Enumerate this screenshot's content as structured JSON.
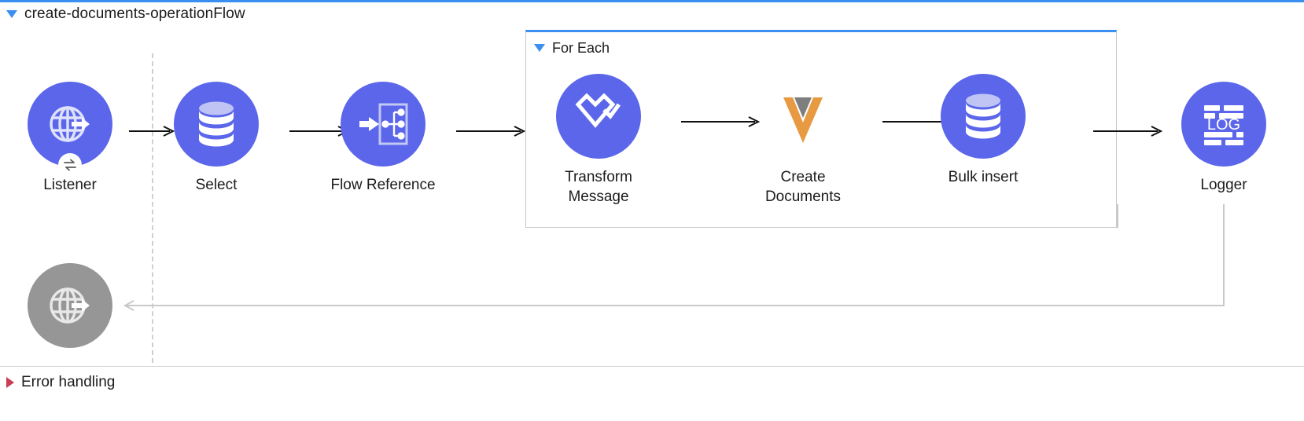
{
  "theme": {
    "accent_blue": "#3b8ff0",
    "node_purple": "#5b66ea",
    "node_gray": "#969696",
    "error_red": "#cc3c54",
    "border_gray": "#c9c9c9",
    "text": "#1b1b1b",
    "doc_orange": "#e89a42",
    "doc_gray": "#7e7e7e"
  },
  "flow": {
    "title": "create-documents-operationFlow",
    "toggle_icon": "triangle-down-icon"
  },
  "scope": {
    "title": "For Each",
    "toggle_icon": "triangle-down-icon"
  },
  "nodes": {
    "listener": {
      "label": "Listener",
      "icon": "globe-arrow-icon",
      "badge_icon": "exchange-arrows-icon"
    },
    "select": {
      "label": "Select",
      "icon": "database-icon"
    },
    "flow_reference": {
      "label": "Flow Reference",
      "icon": "flow-reference-icon"
    },
    "transform_message": {
      "label": "Transform\nMessage",
      "icon": "dataweave-icon"
    },
    "create_documents": {
      "label": "Create Documents",
      "icon": "documents-v-icon"
    },
    "bulk_insert": {
      "label": "Bulk insert",
      "icon": "database-icon"
    },
    "logger": {
      "label": "Logger",
      "icon": "log-icon",
      "icon_text": "LOG"
    },
    "error_source": {
      "label": "",
      "icon": "globe-arrow-icon"
    }
  },
  "error_handling": {
    "title": "Error handling",
    "toggle_icon": "triangle-right-icon"
  }
}
